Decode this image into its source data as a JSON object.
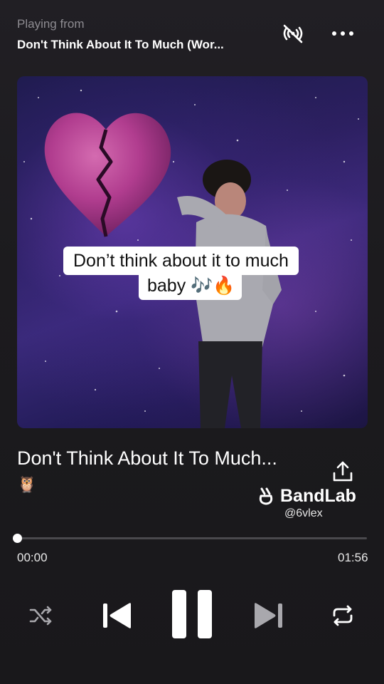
{
  "header": {
    "playing_from_label": "Playing from",
    "playlist_title": "Don't Think About It To Much (Wor..."
  },
  "cover": {
    "lyric_line1": "Don’t think about it to much",
    "lyric_line2": "baby 🎶🔥"
  },
  "track": {
    "title": "Don't Think About It To Much...",
    "emoji": "🦉",
    "platform": "BandLab",
    "handle": "@6vlex"
  },
  "progress": {
    "elapsed": "00:00",
    "total": "01:56",
    "fraction": 0.0
  },
  "colors": {
    "background": "#1b1a1d",
    "accent": "#ffffff",
    "muted": "#8e8c92",
    "inactive_icon": "#a9a8ad"
  },
  "icons": {
    "cast": "cast-off-icon",
    "more": "more-horizontal-icon",
    "share": "share-icon",
    "bandlab_logo": "bandlab-logo-icon",
    "shuffle": "shuffle-icon",
    "previous": "skip-previous-icon",
    "pause": "pause-icon",
    "next": "skip-next-icon",
    "repeat": "repeat-icon"
  }
}
